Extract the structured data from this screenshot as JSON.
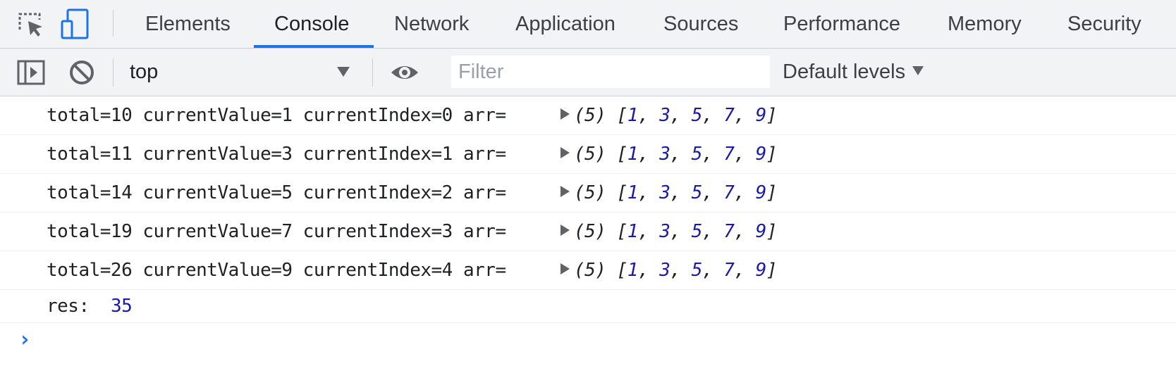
{
  "tabs": [
    {
      "label": "Elements",
      "active": false
    },
    {
      "label": "Console",
      "active": true
    },
    {
      "label": "Network",
      "active": false
    },
    {
      "label": "Application",
      "active": false
    },
    {
      "label": "Sources",
      "active": false
    },
    {
      "label": "Performance",
      "active": false
    },
    {
      "label": "Memory",
      "active": false
    },
    {
      "label": "Security",
      "active": false
    }
  ],
  "toolbar": {
    "context_value": "top",
    "filter_placeholder": "Filter",
    "levels_label": "Default levels"
  },
  "messages": [
    {
      "text": "total=10 currentValue=1 currentIndex=0 arr=",
      "count": "(5)",
      "array": [
        "1",
        "3",
        "5",
        "7",
        "9"
      ]
    },
    {
      "text": "total=11 currentValue=3 currentIndex=1 arr=",
      "count": "(5)",
      "array": [
        "1",
        "3",
        "5",
        "7",
        "9"
      ]
    },
    {
      "text": "total=14 currentValue=5 currentIndex=2 arr=",
      "count": "(5)",
      "array": [
        "1",
        "3",
        "5",
        "7",
        "9"
      ]
    },
    {
      "text": "total=19 currentValue=7 currentIndex=3 arr=",
      "count": "(5)",
      "array": [
        "1",
        "3",
        "5",
        "7",
        "9"
      ]
    },
    {
      "text": "total=26 currentValue=9 currentIndex=4 arr=",
      "count": "(5)",
      "array": [
        "1",
        "3",
        "5",
        "7",
        "9"
      ]
    }
  ],
  "result": {
    "label": "res:",
    "value": "35"
  },
  "prompt": "›",
  "colors": {
    "accent": "#1a73e8",
    "number": "#1a1aa6",
    "toolbar_bg": "#f1f3f4"
  }
}
